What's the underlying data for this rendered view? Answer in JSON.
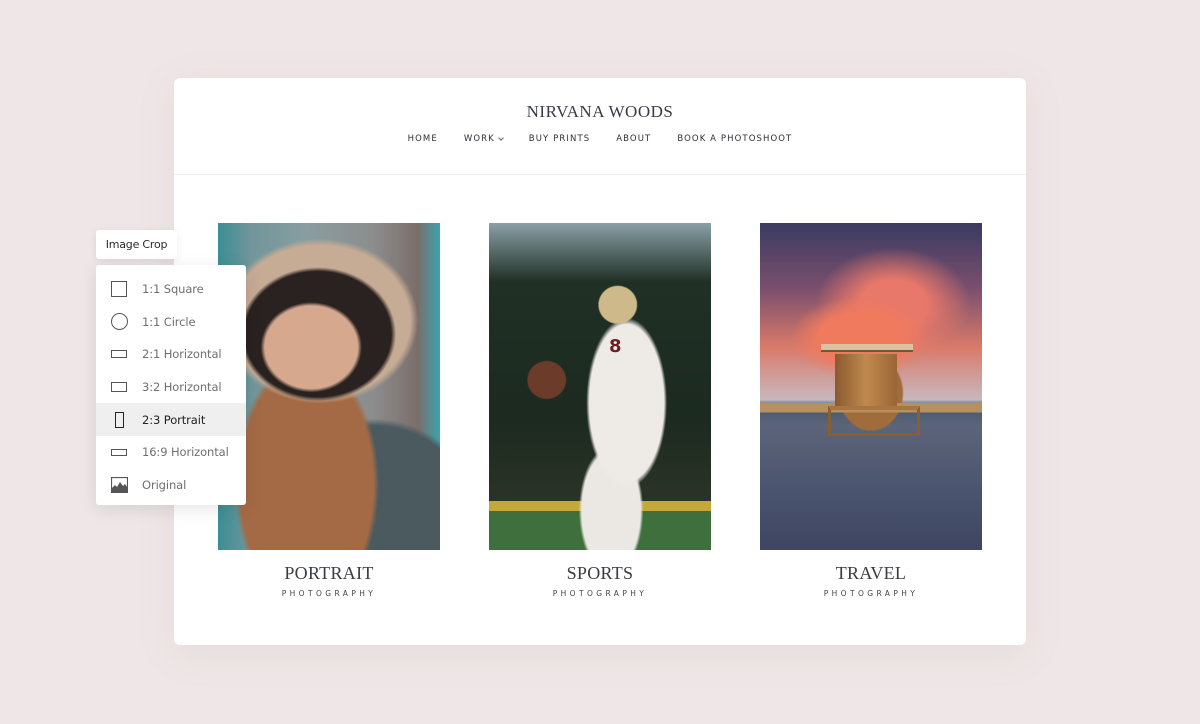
{
  "site": {
    "title": "NIRVANA WOODS",
    "nav": [
      {
        "label": "HOME"
      },
      {
        "label": "WORK",
        "has_dropdown": true
      },
      {
        "label": "BUY PRINTS"
      },
      {
        "label": "ABOUT"
      },
      {
        "label": "BOOK A PHOTOSHOOT"
      }
    ]
  },
  "gallery": [
    {
      "title": "PORTRAIT",
      "subtitle": "PHOTOGRAPHY",
      "image": "woman in fur-trimmed hood"
    },
    {
      "title": "SPORTS",
      "subtitle": "PHOTOGRAPHY",
      "image": "football quarterback number 8",
      "jersey_number": "8"
    },
    {
      "title": "TRAVEL",
      "subtitle": "PHOTOGRAPHY",
      "image": "lifeguard hut on beach at sunset"
    }
  ],
  "image_crop": {
    "label": "Image Crop",
    "selected": "2:3 Portrait",
    "options": [
      {
        "label": "1:1 Square",
        "icon": "square-icon"
      },
      {
        "label": "1:1 Circle",
        "icon": "circle-icon"
      },
      {
        "label": "2:1 Horizontal",
        "icon": "rect-2-1-icon"
      },
      {
        "label": "3:2 Horizontal",
        "icon": "rect-3-2-icon"
      },
      {
        "label": "2:3 Portrait",
        "icon": "rect-2-3-icon"
      },
      {
        "label": "16:9 Horizontal",
        "icon": "rect-16-9-icon"
      },
      {
        "label": "Original",
        "icon": "image-icon"
      }
    ]
  }
}
